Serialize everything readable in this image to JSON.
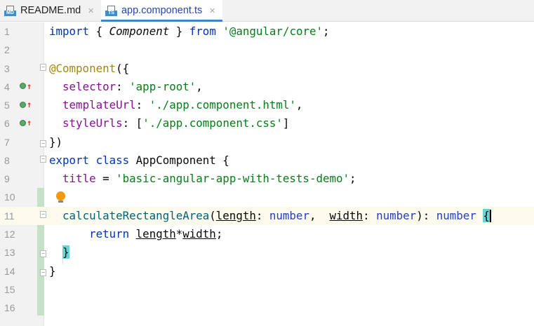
{
  "tabs": [
    {
      "label": "README.md",
      "badge": "MD",
      "active": false
    },
    {
      "label": "app.component.ts",
      "badge": "TS",
      "active": true
    }
  ],
  "close_glyph": "×",
  "current_line": 11,
  "lines": [
    [
      [
        "import",
        "kw"
      ],
      [
        " { ",
        ""
      ],
      [
        "Component",
        "it"
      ],
      [
        " } ",
        ""
      ],
      [
        "from",
        "kw"
      ],
      [
        " ",
        ""
      ],
      [
        "'@angular/core'",
        "str"
      ],
      [
        ";",
        ""
      ]
    ],
    [],
    [
      [
        "@Component",
        "ann"
      ],
      [
        "({",
        ""
      ]
    ],
    [
      [
        "  ",
        ""
      ],
      [
        "selector",
        "prop"
      ],
      [
        ": ",
        ""
      ],
      [
        "'app-root'",
        "str"
      ],
      [
        ",",
        ""
      ]
    ],
    [
      [
        "  ",
        ""
      ],
      [
        "templateUrl",
        "prop"
      ],
      [
        ": ",
        ""
      ],
      [
        "'./app.component.html'",
        "str"
      ],
      [
        ",",
        ""
      ]
    ],
    [
      [
        "  ",
        ""
      ],
      [
        "styleUrls",
        "prop"
      ],
      [
        ": [",
        ""
      ],
      [
        "'./app.component.css'",
        "str"
      ],
      [
        "]",
        ""
      ]
    ],
    [
      [
        "})",
        ""
      ]
    ],
    [
      [
        "export",
        "kw"
      ],
      [
        " ",
        ""
      ],
      [
        "class",
        "kw"
      ],
      [
        " AppComponent {",
        ""
      ]
    ],
    [
      [
        "  ",
        ""
      ],
      [
        "title",
        "prop"
      ],
      [
        " = ",
        ""
      ],
      [
        "'basic-angular-app-with-tests-demo'",
        "str"
      ],
      [
        ";",
        ""
      ]
    ],
    [],
    [
      [
        "  ",
        ""
      ],
      [
        "calculateRectangleArea",
        "fn"
      ],
      [
        "(",
        ""
      ],
      [
        "length",
        "par"
      ],
      [
        ": ",
        ""
      ],
      [
        "number",
        "ty"
      ],
      [
        ",  ",
        ""
      ],
      [
        "width",
        "par"
      ],
      [
        ": ",
        ""
      ],
      [
        "number",
        "ty"
      ],
      [
        "): ",
        ""
      ],
      [
        "number",
        "ty"
      ],
      [
        " ",
        ""
      ],
      [
        "{",
        "brm"
      ]
    ],
    [
      [
        "      ",
        ""
      ],
      [
        "return",
        "kw"
      ],
      [
        " ",
        ""
      ],
      [
        "length",
        "par"
      ],
      [
        "*",
        ""
      ],
      [
        "width",
        "par"
      ],
      [
        ";",
        ""
      ]
    ],
    [
      [
        "  ",
        ""
      ],
      [
        "}",
        "brm"
      ]
    ],
    [
      [
        "}",
        ""
      ]
    ],
    [],
    []
  ]
}
